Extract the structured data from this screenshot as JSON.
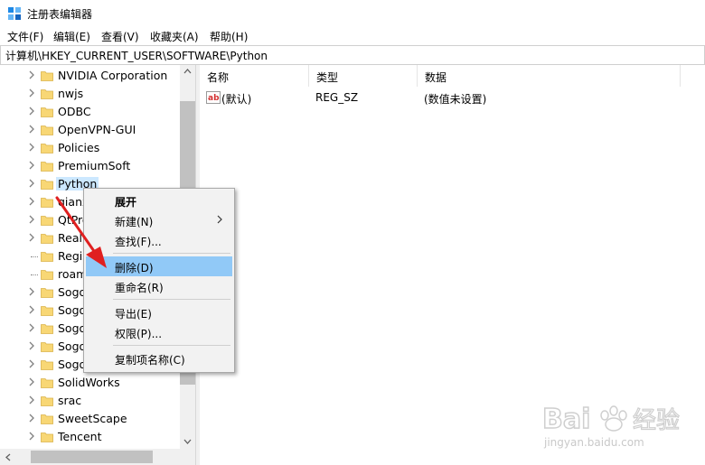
{
  "window": {
    "title": "注册表编辑器",
    "app_icon": "regedit-icon"
  },
  "menubar": {
    "items": [
      "文件(F)",
      "编辑(E)",
      "查看(V)",
      "收藏夹(A)",
      "帮助(H)"
    ]
  },
  "address": {
    "path": "计算机\\HKEY_CURRENT_USER\\SOFTWARE\\Python"
  },
  "tree": {
    "items": [
      {
        "label": "NVIDIA Corporation",
        "expander": "chevron"
      },
      {
        "label": "nwjs",
        "expander": "chevron"
      },
      {
        "label": "ODBC",
        "expander": "chevron"
      },
      {
        "label": "OpenVPN-GUI",
        "expander": "chevron"
      },
      {
        "label": "Policies",
        "expander": "chevron"
      },
      {
        "label": "PremiumSoft",
        "expander": "chevron"
      },
      {
        "label": "Python",
        "expander": "chevron",
        "selected": true
      },
      {
        "label": "qianx",
        "expander": "chevron"
      },
      {
        "label": "QtPro",
        "expander": "chevron"
      },
      {
        "label": "Realt",
        "expander": "chevron"
      },
      {
        "label": "Regis",
        "expander": "dots"
      },
      {
        "label": "roam",
        "expander": "dots"
      },
      {
        "label": "Sogo",
        "expander": "chevron"
      },
      {
        "label": "Sogo",
        "expander": "chevron"
      },
      {
        "label": "Sogo",
        "expander": "chevron"
      },
      {
        "label": "Sogo",
        "expander": "chevron"
      },
      {
        "label": "Sogo",
        "expander": "chevron"
      },
      {
        "label": "SolidWorks",
        "expander": "chevron"
      },
      {
        "label": "srac",
        "expander": "chevron"
      },
      {
        "label": "SweetScape",
        "expander": "chevron"
      },
      {
        "label": "Tencent",
        "expander": "chevron"
      }
    ]
  },
  "list": {
    "headers": [
      "名称",
      "类型",
      "数据"
    ],
    "rows": [
      {
        "name": "(默认)",
        "type": "REG_SZ",
        "data": "(数值未设置)",
        "icon": "string-value-icon"
      }
    ]
  },
  "context_menu": {
    "items": [
      {
        "label": "展开",
        "bold": true
      },
      {
        "label": "新建(N)",
        "submenu": true
      },
      {
        "label": "查找(F)..."
      },
      {
        "separator": true
      },
      {
        "label": "删除(D)",
        "highlighted": true
      },
      {
        "label": "重命名(R)"
      },
      {
        "separator": true
      },
      {
        "label": "导出(E)"
      },
      {
        "label": "权限(P)..."
      },
      {
        "separator": true
      },
      {
        "label": "复制项名称(C)"
      }
    ]
  },
  "watermark": {
    "line1": "Bai",
    "line2": "经验",
    "line3": "jingyan.baidu.com"
  },
  "colors": {
    "selection": "#cce8ff",
    "menu_hover": "#91c9f7",
    "folder": "#f8d775",
    "arrow": "#e02020"
  }
}
